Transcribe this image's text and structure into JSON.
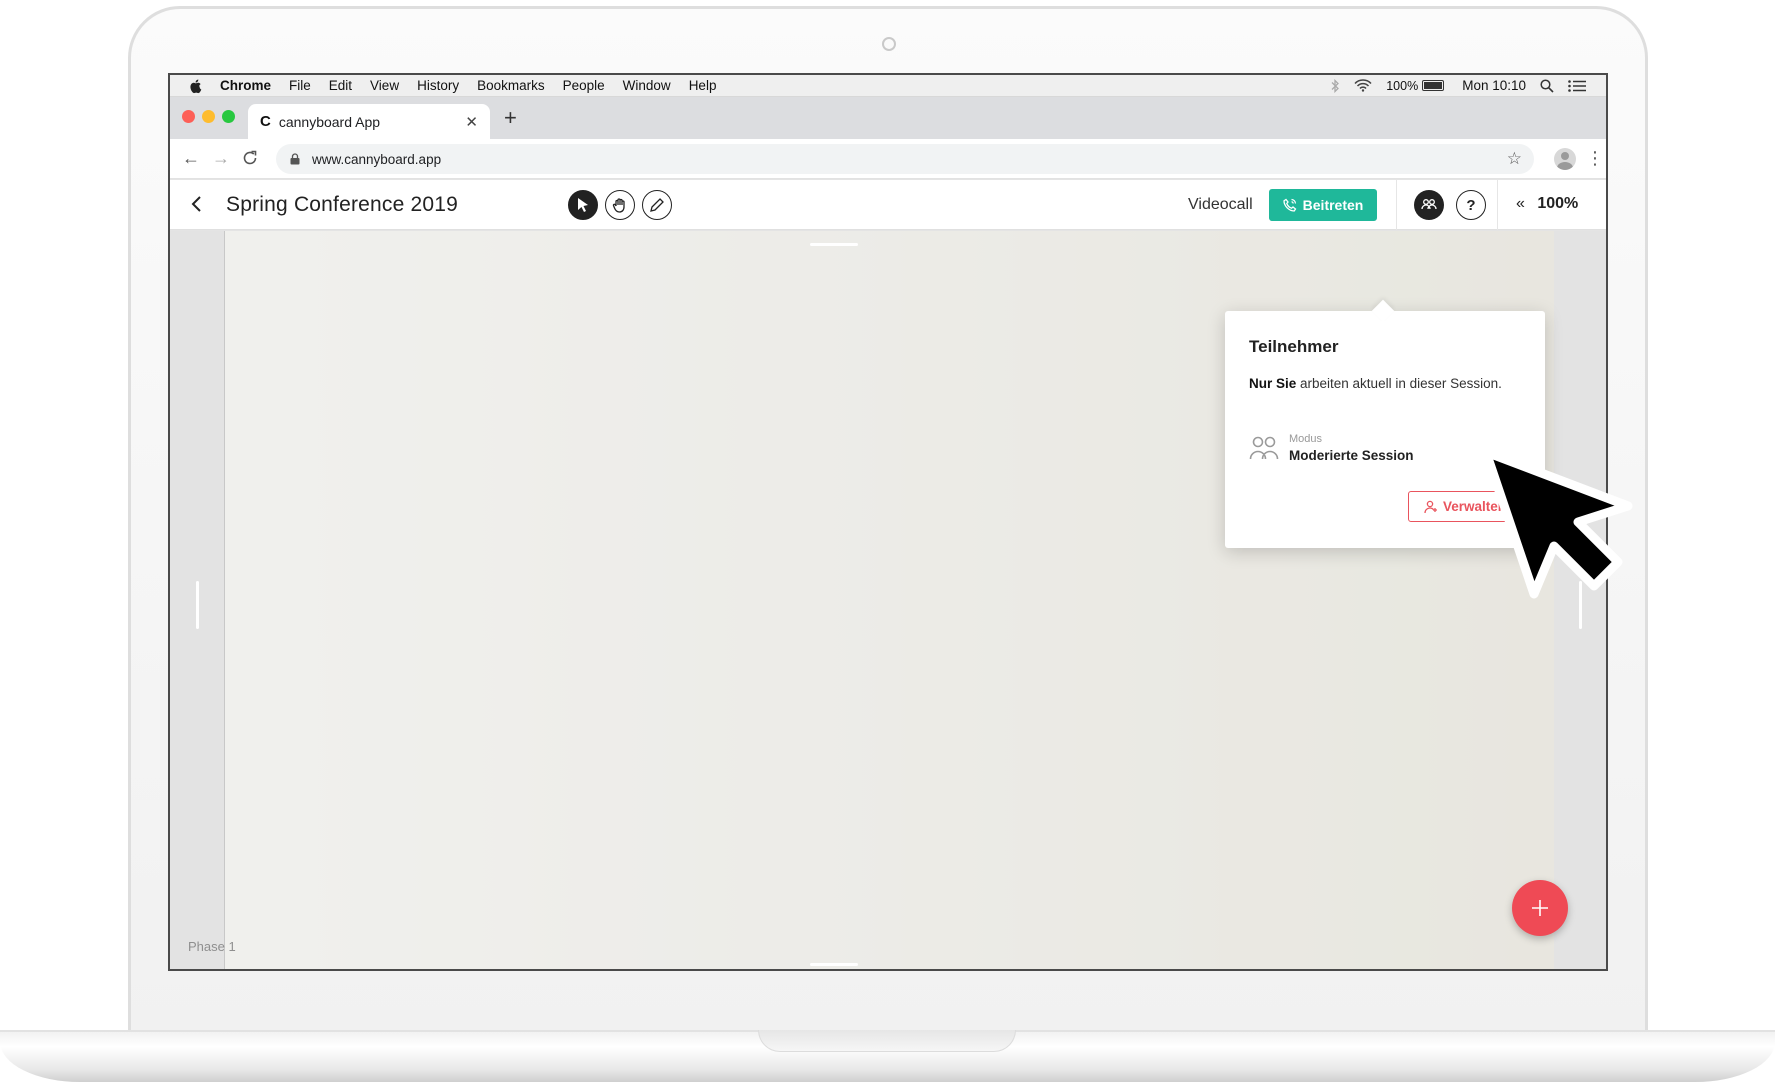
{
  "menubar": {
    "items": [
      "Chrome",
      "File",
      "Edit",
      "View",
      "History",
      "Bookmarks",
      "People",
      "Window",
      "Help"
    ],
    "battery": "100%",
    "clock": "Mon 10:10"
  },
  "browser": {
    "tab_title": "cannyboard App",
    "tab_favicon": "C",
    "url": "www.cannyboard.app"
  },
  "app": {
    "board_title": "Spring Conference 2019",
    "videocall_label": "Videocall",
    "join_label": "Beitreten",
    "help_label": "?",
    "zoom": "100%",
    "zoom_chevron": "«",
    "phase_label": "Phase 1",
    "colors": {
      "accent": "#1fb89a",
      "danger": "#e9545d",
      "fab": "#ef4a55"
    }
  },
  "popover": {
    "title": "Teilnehmer",
    "text_bold": "Nur Sie",
    "text_rest": " arbeiten aktuell in dieser Session.",
    "mode_label": "Modus",
    "mode_value": "Moderierte Session",
    "manage_label": "Verwalten"
  },
  "icons": {
    "tools": [
      "pointer-icon",
      "hand-icon",
      "pen-icon"
    ],
    "header": [
      "back-icon",
      "phone-icon",
      "people-icon",
      "help-icon"
    ],
    "fab": "plus-icon"
  }
}
